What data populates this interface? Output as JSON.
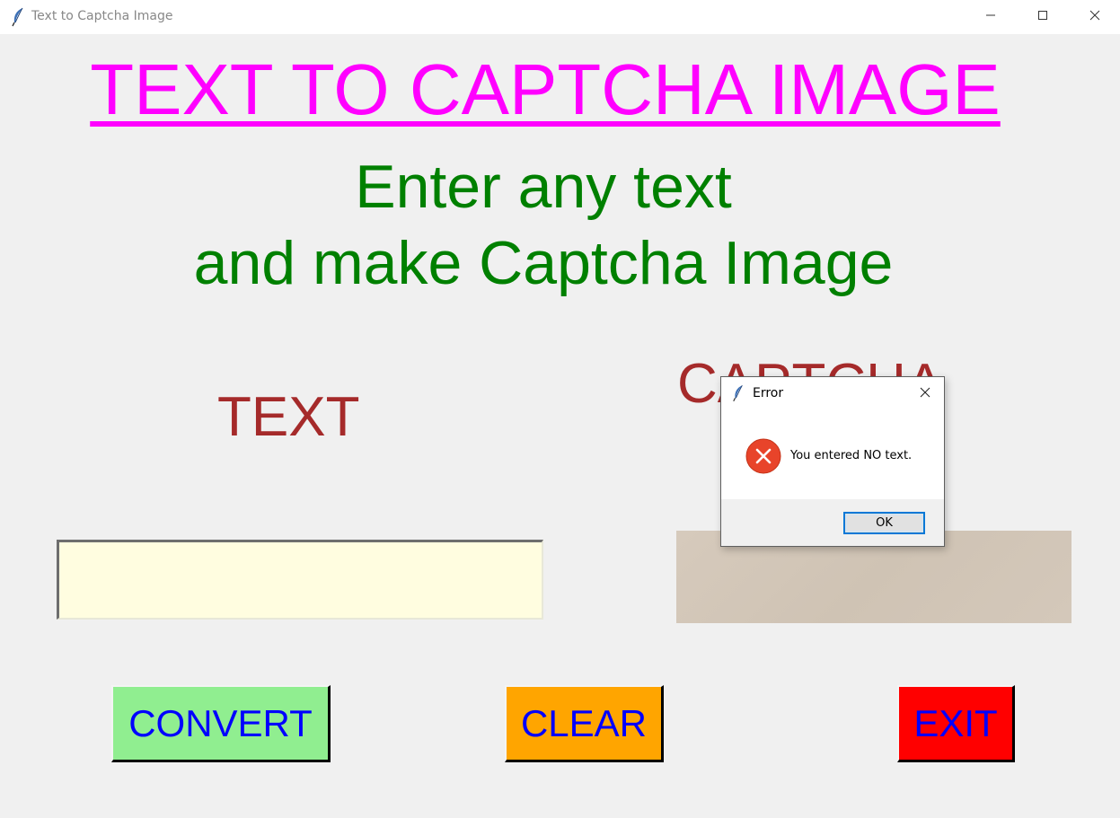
{
  "window": {
    "title": "Text to Captcha Image",
    "icon": "feather-icon"
  },
  "main": {
    "heading": "TEXT TO CAPTCHA IMAGE",
    "subheading_line1": "Enter any text",
    "subheading_line2": "and make Captcha Image",
    "text_label": "TEXT",
    "captcha_label": "CAPTCHA",
    "text_input_value": ""
  },
  "buttons": {
    "convert": "CONVERT",
    "clear": "CLEAR",
    "exit": "EXIT"
  },
  "dialog": {
    "title": "Error",
    "icon": "error-icon",
    "message": "You entered NO text.",
    "ok_label": "OK"
  },
  "colors": {
    "heading": "#ff00ff",
    "subheading": "#008000",
    "label": "#a52a2a",
    "button_text": "#0000ff",
    "convert_bg": "#90ee90",
    "clear_bg": "#ffa500",
    "exit_bg": "#ff0000",
    "entry_bg": "#fffde0"
  }
}
